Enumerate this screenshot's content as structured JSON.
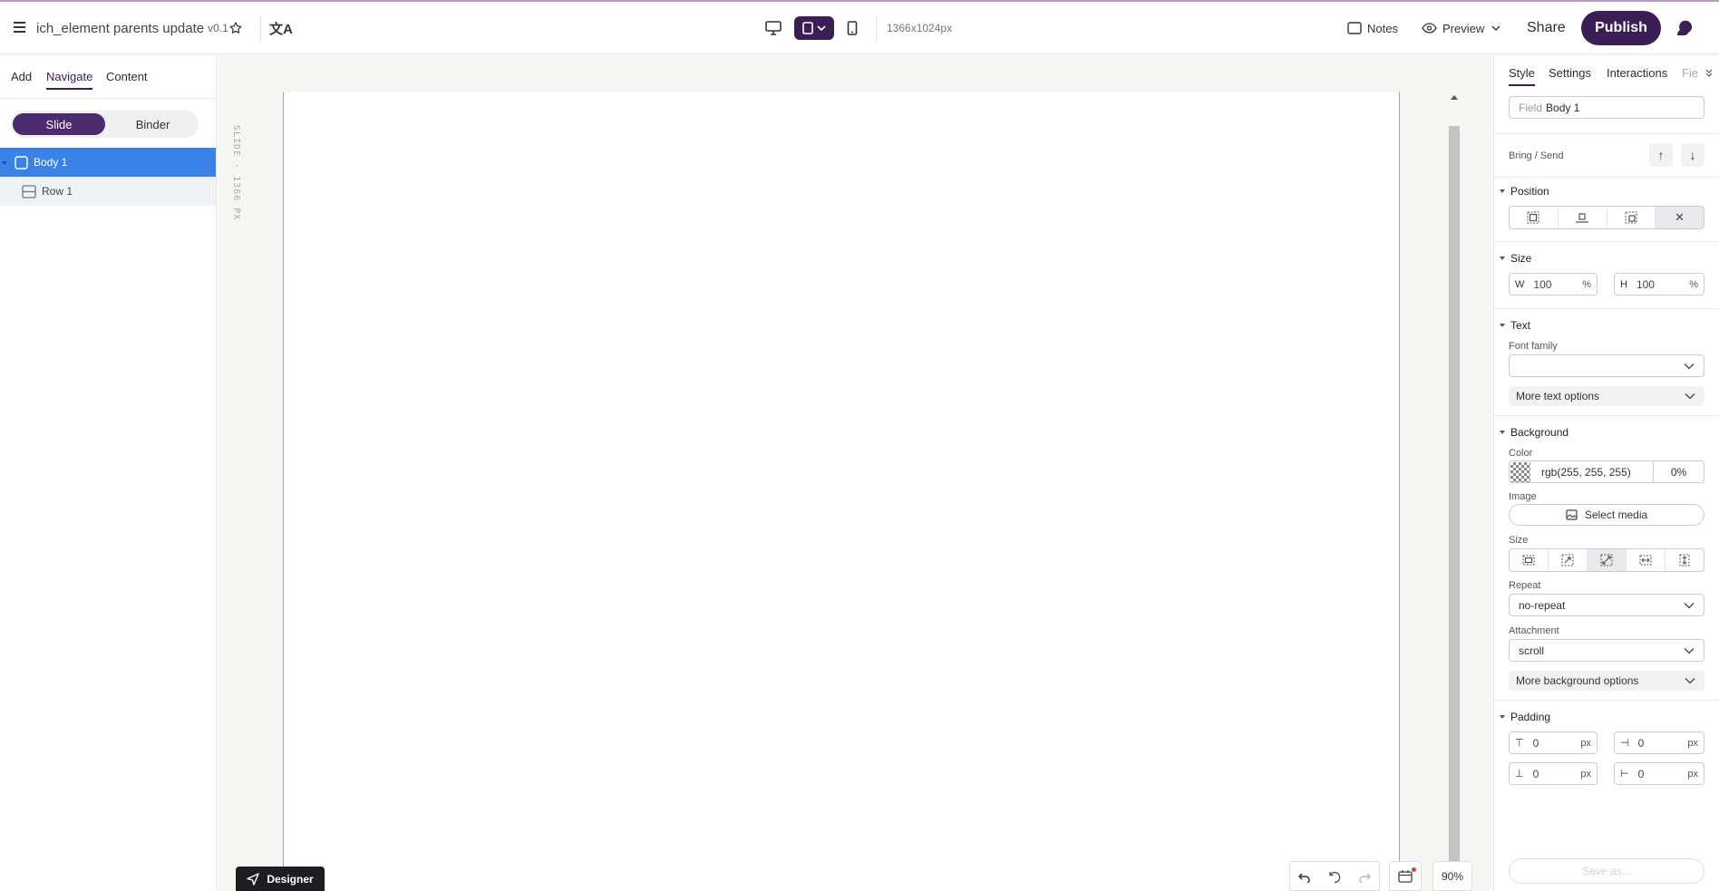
{
  "topbar": {
    "doc_title": "ich_element parents update",
    "version": "v0.1",
    "canvas_size": "1366x1024px",
    "notes_label": "Notes",
    "preview_label": "Preview",
    "share_label": "Share",
    "publish_label": "Publish",
    "translate_glyph": "文A"
  },
  "left": {
    "tabs": [
      "Add",
      "Navigate",
      "Content"
    ],
    "active_tab": "Navigate",
    "segment": [
      "Slide",
      "Binder"
    ],
    "tree": [
      {
        "label": "Body 1",
        "selected": true
      },
      {
        "label": "Row 1",
        "selected": false
      }
    ]
  },
  "workspace": {
    "slide_label": "SLIDE · 1366 PX",
    "designer_label": "Designer",
    "zoom": "90%"
  },
  "right": {
    "tabs": [
      "Style",
      "Settings",
      "Interactions",
      "Fie"
    ],
    "field_placeholder": "Field",
    "field_value": "Body 1",
    "bring_send_label": "Bring / Send",
    "position_title": "Position",
    "size_title": "Size",
    "size_w_prefix": "W",
    "size_w": "100",
    "size_h_prefix": "H",
    "size_h": "100",
    "size_unit": "%",
    "text_title": "Text",
    "font_family_label": "Font family",
    "font_family_value": "",
    "more_text": "More text options",
    "background_title": "Background",
    "color_label": "Color",
    "color_value": "rgb(255, 255, 255)",
    "opacity": "0%",
    "image_label": "Image",
    "select_media": "Select media",
    "bg_size_label": "Size",
    "repeat_label": "Repeat",
    "repeat_value": "no-repeat",
    "attachment_label": "Attachment",
    "attachment_value": "scroll",
    "more_bg": "More background options",
    "padding_title": "Padding",
    "padding_top": "0",
    "padding_right": "0",
    "padding_bottom": "0",
    "padding_left": "0",
    "padding_unit": "px",
    "save_as": "Save as..."
  },
  "colors": {
    "brand": "#3b1e55",
    "selection": "#3b82e8"
  }
}
